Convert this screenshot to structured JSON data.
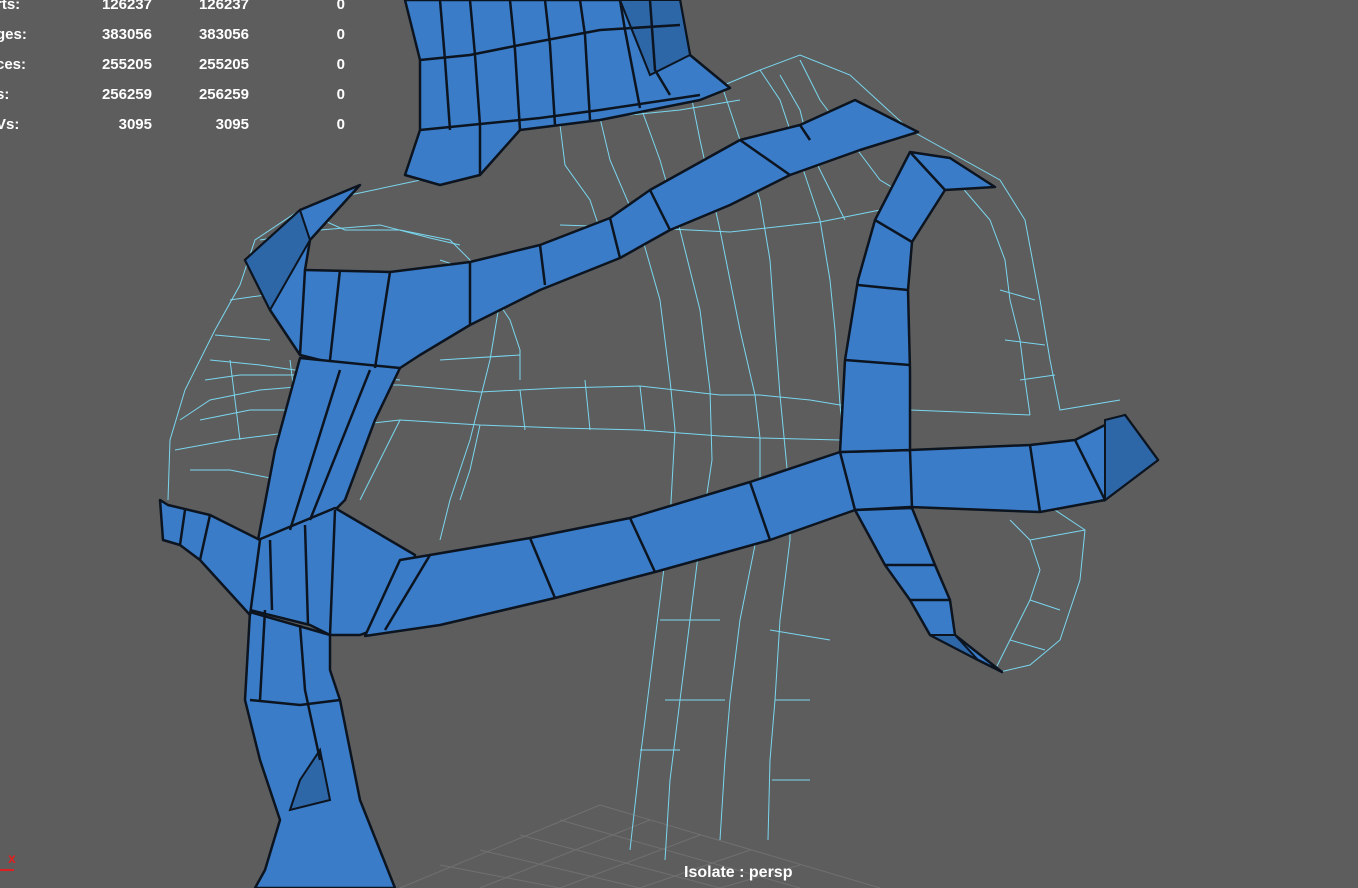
{
  "hud": {
    "rows": [
      {
        "label": "rts:",
        "v1": "126237",
        "v2": "126237",
        "v3": "0"
      },
      {
        "label": "ges:",
        "v1": "383056",
        "v2": "383056",
        "v3": "0"
      },
      {
        "label": "ces:",
        "v1": "255205",
        "v2": "255205",
        "v3": "0"
      },
      {
        "label": "s:",
        "v1": "256259",
        "v2": "256259",
        "v3": "0"
      },
      {
        "label": "Vs:",
        "v1": "3095",
        "v2": "3095",
        "v3": "0"
      }
    ]
  },
  "viewport": {
    "label": "Isolate : persp",
    "axis_label": "x"
  },
  "colors": {
    "background": "#5d5d5d",
    "selected_face": "#3a7cc8",
    "wireframe": "#7ad6ee",
    "edge": "#0c1420",
    "grid": "#707070",
    "axis_x": "#e02020"
  }
}
